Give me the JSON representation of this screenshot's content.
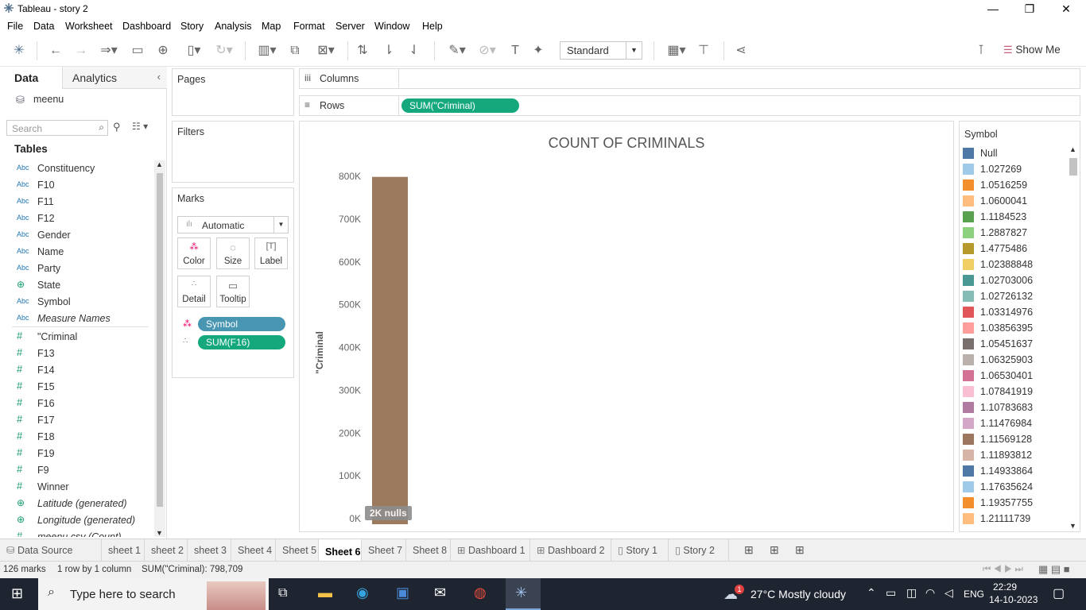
{
  "window": {
    "title": "Tableau - story 2",
    "min": "—",
    "max": "❐",
    "close": "✕"
  },
  "menu": [
    "File",
    "Data",
    "Worksheet",
    "Dashboard",
    "Story",
    "Analysis",
    "Map",
    "Format",
    "Server",
    "Window",
    "Help"
  ],
  "toolbar": {
    "fit_value": "Standard",
    "show_me": "Show Me"
  },
  "left_pane": {
    "tabs": [
      "Data",
      "Analytics"
    ],
    "datasource": "meenu",
    "search_placeholder": "Search",
    "tables_heading": "Tables",
    "fields": [
      {
        "icon": "Abc",
        "name": "Constituency",
        "italic": false
      },
      {
        "icon": "Abc",
        "name": "F10",
        "italic": false
      },
      {
        "icon": "Abc",
        "name": "F11",
        "italic": false
      },
      {
        "icon": "Abc",
        "name": "F12",
        "italic": false
      },
      {
        "icon": "Abc",
        "name": "Gender",
        "italic": false
      },
      {
        "icon": "Abc",
        "name": "Name",
        "italic": false
      },
      {
        "icon": "Abc",
        "name": "Party",
        "italic": false
      },
      {
        "icon": "geo",
        "name": "State",
        "italic": false
      },
      {
        "icon": "Abc",
        "name": "Symbol",
        "italic": false
      },
      {
        "icon": "Abc",
        "name": "Measure Names",
        "italic": true
      },
      {
        "icon": "#",
        "name": "\"Criminal",
        "italic": false
      },
      {
        "icon": "#",
        "name": "F13",
        "italic": false
      },
      {
        "icon": "#",
        "name": "F14",
        "italic": false
      },
      {
        "icon": "#",
        "name": "F15",
        "italic": false
      },
      {
        "icon": "#",
        "name": "F16",
        "italic": false
      },
      {
        "icon": "#",
        "name": "F17",
        "italic": false
      },
      {
        "icon": "#",
        "name": "F18",
        "italic": false
      },
      {
        "icon": "#",
        "name": "F19",
        "italic": false
      },
      {
        "icon": "#",
        "name": "F9",
        "italic": false
      },
      {
        "icon": "#",
        "name": "Winner",
        "italic": false
      },
      {
        "icon": "geo",
        "name": "Latitude (generated)",
        "italic": true
      },
      {
        "icon": "geo",
        "name": "Longitude (generated)",
        "italic": true
      },
      {
        "icon": "#",
        "name": "meenu.csv (Count)",
        "italic": true
      }
    ]
  },
  "cards": {
    "pages": "Pages",
    "filters": "Filters",
    "marks": "Marks",
    "mark_type": "Automatic",
    "mark_buttons": [
      "Color",
      "Size",
      "Label",
      "Detail",
      "Tooltip"
    ],
    "mark_pills": [
      "Symbol",
      "SUM(F16)"
    ]
  },
  "shelves": {
    "columns_label": "Columns",
    "rows_label": "Rows",
    "rows_pill": "SUM(\"Criminal)"
  },
  "chart_data": {
    "type": "bar",
    "title": "COUNT OF CRIMINALS",
    "xlabel": "",
    "ylabel": "\"Criminal",
    "ylim": [
      0,
      800000
    ],
    "yticks": [
      "0K",
      "100K",
      "200K",
      "300K",
      "400K",
      "500K",
      "600K",
      "700K",
      "800K"
    ],
    "categories": [
      ""
    ],
    "values": [
      798709
    ],
    "bar_color": "#9c7a5e",
    "null_indicator": "2K nulls"
  },
  "legend": {
    "title": "Symbol",
    "items": [
      {
        "label": "Null",
        "color": "#4e79a7"
      },
      {
        "label": "1.027269",
        "color": "#a0cbe8"
      },
      {
        "label": "1.0516259",
        "color": "#f28e2b"
      },
      {
        "label": "1.0600041",
        "color": "#ffbe7d"
      },
      {
        "label": "1.1184523",
        "color": "#59a14f"
      },
      {
        "label": "1.2887827",
        "color": "#8cd17d"
      },
      {
        "label": "1.4775486",
        "color": "#b6992d"
      },
      {
        "label": "1.02388848",
        "color": "#f1ce63"
      },
      {
        "label": "1.02703006",
        "color": "#499894"
      },
      {
        "label": "1.02726132",
        "color": "#86bcb6"
      },
      {
        "label": "1.03314976",
        "color": "#e15759"
      },
      {
        "label": "1.03856395",
        "color": "#ff9d9a"
      },
      {
        "label": "1.05451637",
        "color": "#79706e"
      },
      {
        "label": "1.06325903",
        "color": "#bab0ac"
      },
      {
        "label": "1.06530401",
        "color": "#d37295"
      },
      {
        "label": "1.07841919",
        "color": "#fabfd2"
      },
      {
        "label": "1.10783683",
        "color": "#b07aa1"
      },
      {
        "label": "1.11476984",
        "color": "#d4a6c8"
      },
      {
        "label": "1.11569128",
        "color": "#9d7660"
      },
      {
        "label": "1.11893812",
        "color": "#d7b5a6"
      },
      {
        "label": "1.14933864",
        "color": "#4e79a7"
      },
      {
        "label": "1.17635624",
        "color": "#a0cbe8"
      },
      {
        "label": "1.19357755",
        "color": "#f28e2b"
      },
      {
        "label": "1.21111739",
        "color": "#ffbe7d"
      }
    ]
  },
  "sheet_tabs": [
    {
      "label": "Data Source",
      "type": "ds",
      "active": false
    },
    {
      "label": "sheet 1",
      "type": "sheet",
      "active": false
    },
    {
      "label": "sheet 2",
      "type": "sheet",
      "active": false
    },
    {
      "label": "sheet 3",
      "type": "sheet",
      "active": false
    },
    {
      "label": "Sheet 4",
      "type": "sheet",
      "active": false
    },
    {
      "label": "Sheet 5",
      "type": "sheet",
      "active": false
    },
    {
      "label": "Sheet 6",
      "type": "sheet",
      "active": true
    },
    {
      "label": "Sheet 7",
      "type": "sheet",
      "active": false
    },
    {
      "label": "Sheet 8",
      "type": "sheet",
      "active": false
    },
    {
      "label": "Dashboard 1",
      "type": "dash",
      "active": false
    },
    {
      "label": "Dashboard 2",
      "type": "dash",
      "active": false
    },
    {
      "label": "Story 1",
      "type": "story",
      "active": false
    },
    {
      "label": "Story 2",
      "type": "story",
      "active": false
    }
  ],
  "status": {
    "marks": "126 marks",
    "dims": "1 row by 1 column",
    "sum": "SUM(\"Criminal): 798,709"
  },
  "taskbar": {
    "search_placeholder": "Type here to search",
    "weather": "27°C  Mostly cloudy",
    "weather_badge": "1",
    "lang": "ENG",
    "time": "22:29",
    "date": "14-10-2023"
  }
}
